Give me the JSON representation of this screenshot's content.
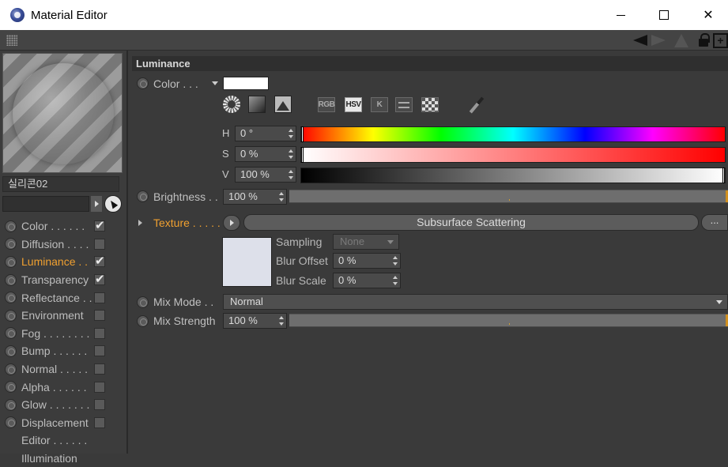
{
  "window": {
    "title": "Material Editor"
  },
  "left_panel": {
    "material_name": "실리콘02",
    "channels": [
      {
        "label": "Color . . . . . .",
        "checked": true,
        "active": false
      },
      {
        "label": "Diffusion . . . .",
        "checked": false,
        "active": false
      },
      {
        "label": "Luminance . .",
        "checked": true,
        "active": true
      },
      {
        "label": "Transparency",
        "checked": true,
        "active": false
      },
      {
        "label": "Reflectance . .",
        "checked": false,
        "active": false
      },
      {
        "label": "Environment",
        "checked": false,
        "active": false
      },
      {
        "label": "Fog . . . . . . . .",
        "checked": false,
        "active": false
      },
      {
        "label": "Bump . . . . . .",
        "checked": false,
        "active": false
      },
      {
        "label": "Normal . . . . .",
        "checked": false,
        "active": false
      },
      {
        "label": "Alpha . . . . . .",
        "checked": false,
        "active": false
      },
      {
        "label": "Glow . . . . . . .",
        "checked": false,
        "active": false
      },
      {
        "label": "Displacement",
        "checked": false,
        "active": false
      },
      {
        "label": "Editor . . . . . .",
        "checked": null,
        "active": false
      },
      {
        "label": "Illumination",
        "checked": null,
        "active": false
      }
    ]
  },
  "luminance": {
    "section_title": "Luminance",
    "color_label": "Color . . .",
    "color_swatch": "#ffffff",
    "mode_buttons": {
      "rgb": "RGB",
      "hsv": "HSV",
      "k": "K"
    },
    "h": {
      "label": "H",
      "value": "0 °",
      "fraction": 0.0
    },
    "s": {
      "label": "S",
      "value": "0 %",
      "fraction": 0.0
    },
    "v": {
      "label": "V",
      "value": "100 %",
      "fraction": 1.0
    },
    "brightness": {
      "label": "Brightness . .",
      "value": "100 %"
    },
    "texture": {
      "label": "Texture . . . . .",
      "shader": "Subsurface Scattering",
      "more": "...",
      "sampling": {
        "label": "Sampling",
        "value": "None"
      },
      "blur_offset": {
        "label": "Blur Offset",
        "value": "0 %"
      },
      "blur_scale": {
        "label": "Blur Scale",
        "value": "0 %"
      }
    },
    "mix_mode": {
      "label": "Mix Mode . .",
      "value": "Normal"
    },
    "mix_strength": {
      "label": "Mix Strength",
      "value": "100 %"
    }
  },
  "colors": {
    "active_channel": "#f0a030",
    "panel_bg": "#3a3a3a"
  }
}
